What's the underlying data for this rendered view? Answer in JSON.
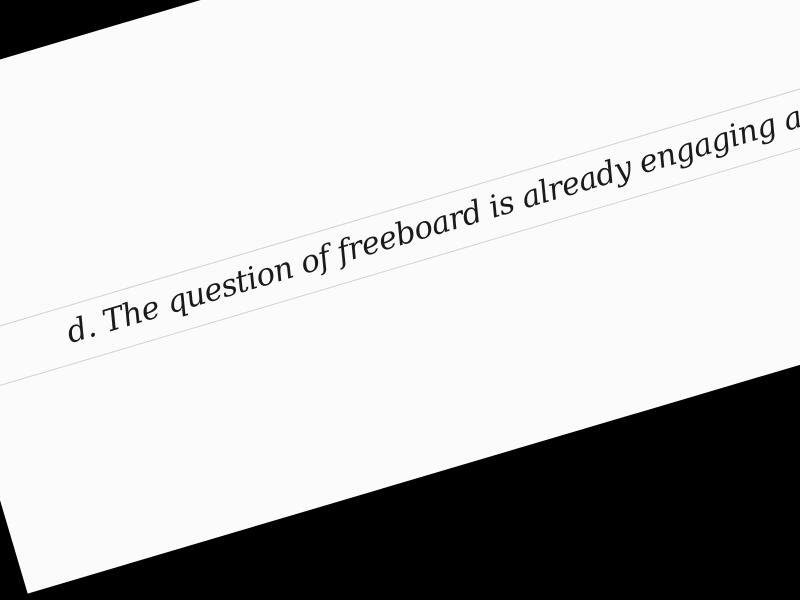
{
  "document": {
    "handwritten_line": "d. The question of freeboard is already engaging attention; the other"
  }
}
